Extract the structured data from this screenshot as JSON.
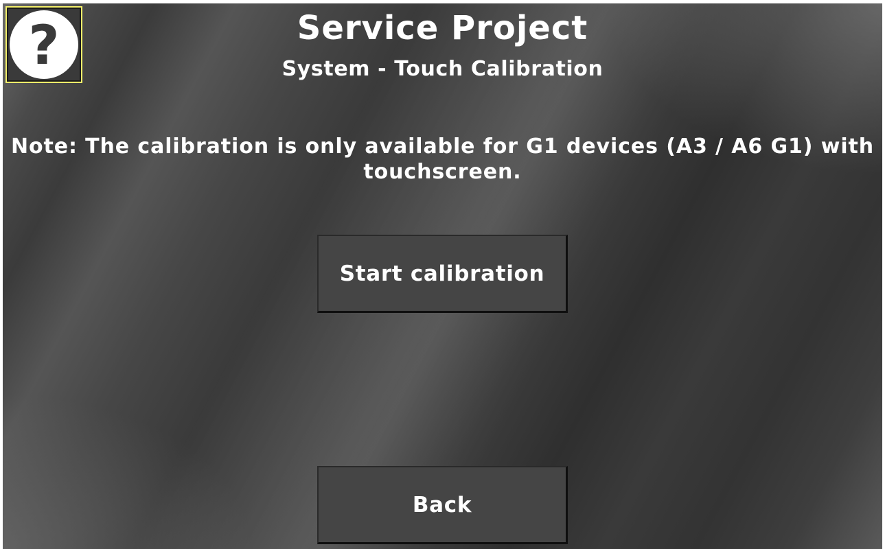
{
  "header": {
    "title": "Service Project",
    "subtitle": "System - Touch Calibration"
  },
  "help": {
    "icon": "help-question-icon",
    "glyph": "?"
  },
  "main": {
    "note": "Note: The calibration is only available for G1 devices (A3 / A6 G1) with touchscreen.",
    "start_label": "Start calibration"
  },
  "footer": {
    "back_label": "Back"
  },
  "colors": {
    "help_border": "#f4f06a",
    "button_bg": "#454545",
    "text": "#ffffff"
  }
}
